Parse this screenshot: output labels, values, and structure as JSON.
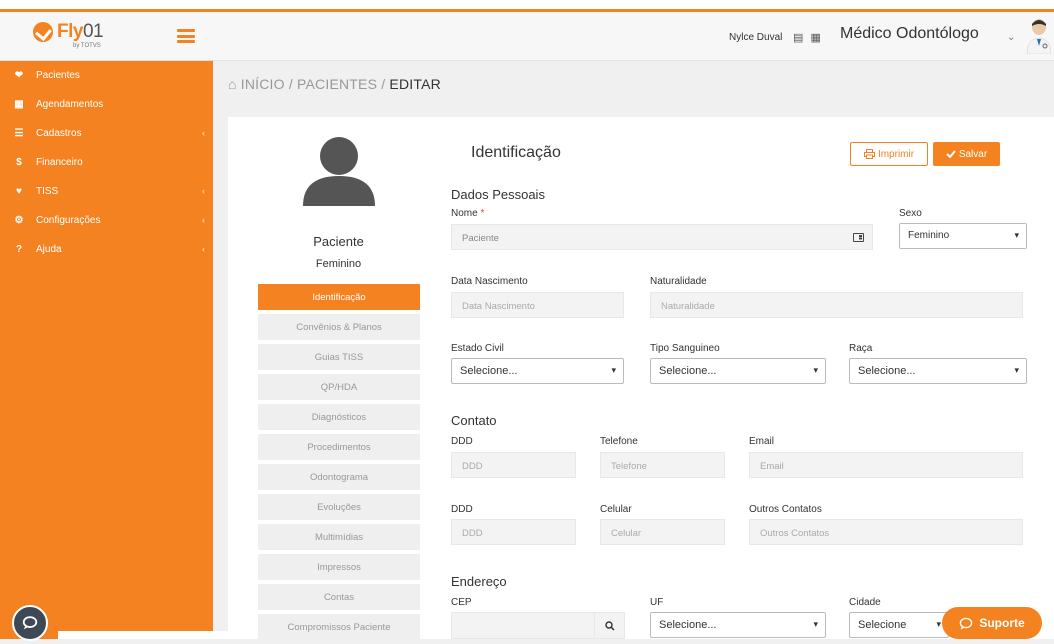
{
  "brand": {
    "name": "Fly",
    "suffix": "01",
    "byline": "by TOTVS"
  },
  "colors": {
    "accent": "#f58220",
    "sidebar": "#f58220",
    "header_bg": "#f7f7f7"
  },
  "sidebar": {
    "items": [
      {
        "icon": "users-icon",
        "glyph": "❤",
        "label": "Pacientes",
        "has_sub": false
      },
      {
        "icon": "calendar-icon",
        "glyph": "▦",
        "label": "Agendamentos",
        "has_sub": false
      },
      {
        "icon": "list-icon",
        "glyph": "☰",
        "label": "Cadastros",
        "has_sub": true
      },
      {
        "icon": "dollar-icon",
        "glyph": "$",
        "label": "Financeiro",
        "has_sub": false
      },
      {
        "icon": "heartbeat-icon",
        "glyph": "♥",
        "label": "TISS",
        "has_sub": true
      },
      {
        "icon": "gear-icon",
        "glyph": "⚙",
        "label": "Configurações",
        "has_sub": true
      },
      {
        "icon": "question-icon",
        "glyph": "?",
        "label": "Ajuda",
        "has_sub": true
      }
    ]
  },
  "header": {
    "user_name": "Nylce Duval",
    "icons": "▤ ▦",
    "role": "Médico Odontólogo",
    "role_chevron": "⌄"
  },
  "breadcrumb": {
    "home_icon": "⌂",
    "home": "INÍCIO",
    "sep": "/",
    "patients": "PACIENTES",
    "current": "EDITAR"
  },
  "patient": {
    "name": "Paciente",
    "sex": "Feminino"
  },
  "tabs": [
    "Identificação",
    "Convênios & Planos",
    "Guias TISS",
    "QP/HDA",
    "Diagnósticos",
    "Procedimentos",
    "Odontograma",
    "Evoluções",
    "Multimídias",
    "Impressos",
    "Contas",
    "Compromissos Paciente"
  ],
  "form": {
    "title": "Identificação",
    "print_label": "Imprimir",
    "save_label": "Salvar",
    "personal": {
      "section": "Dados Pessoais",
      "nome_label": "Nome",
      "nome_required": "*",
      "nome_value": "Paciente",
      "sexo_label": "Sexo",
      "sexo_value": "Feminino",
      "nasc_label": "Data Nascimento",
      "nasc_placeholder": "Data Nascimento",
      "nat_label": "Naturalidade",
      "nat_placeholder": "Naturalidade",
      "civil_label": "Estado Civil",
      "civil_value": "Selecione...",
      "blood_label": "Tipo Sanguineo",
      "blood_value": "Selecione...",
      "race_label": "Raça",
      "race_value": "Selecione..."
    },
    "contact": {
      "section": "Contato",
      "ddd1_label": "DDD",
      "ddd1_placeholder": "DDD",
      "phone_label": "Telefone",
      "phone_placeholder": "Telefone",
      "email_label": "Email",
      "email_placeholder": "Email",
      "ddd2_label": "DDD",
      "ddd2_placeholder": "DDD",
      "cell_label": "Celular",
      "cell_placeholder": "Celular",
      "other_label": "Outros Contatos",
      "other_placeholder": "Outros Contatos"
    },
    "address": {
      "section": "Endereço",
      "cep_label": "CEP",
      "uf_label": "UF",
      "uf_value": "Selecione...",
      "city_label": "Cidade",
      "city_value": "Selecione"
    }
  },
  "support": {
    "label": "Suporte"
  }
}
